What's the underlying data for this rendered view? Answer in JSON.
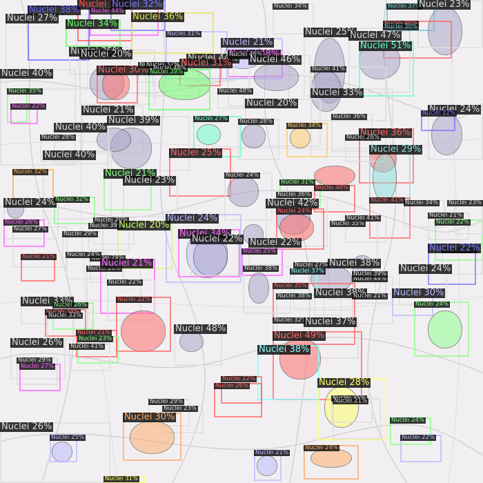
{
  "image": {
    "kind": "instance segmentation output over a microscopy photo",
    "class_name": "Nuclei"
  },
  "detections": [
    {
      "score": "Nuclei 38%",
      "color": "#6666ff",
      "size": "big"
    },
    {
      "score": "Nuclei 27%",
      "color": "#e0e0e0",
      "size": "big"
    },
    {
      "score": "Nuclei 25%",
      "color": "#ff4d4d",
      "size": "big"
    },
    {
      "score": "Nuclei 32%",
      "color": "#7777ff",
      "size": "big"
    },
    {
      "score": "Nuclei 37%",
      "color": "#66cccc",
      "size": "small"
    },
    {
      "score": "Nuclei 34%",
      "color": "#dddddd",
      "size": "small"
    },
    {
      "score": "Nuclei 23%",
      "color": "#dddddd",
      "size": "big"
    },
    {
      "score": "Nuclei 36%",
      "color": "#e6e64c",
      "size": "big"
    },
    {
      "score": "Nuclei 34%",
      "color": "#66ff66",
      "size": "big"
    },
    {
      "score": "Nuclei 44%",
      "color": "#ff66ff",
      "size": "small"
    },
    {
      "score": "Nuclei 40%",
      "color": "#ff6666",
      "size": "small"
    },
    {
      "score": "Nuclei 30%",
      "color": "#5fd6d6",
      "size": "small"
    },
    {
      "score": "Nuclei 31%",
      "color": "#bbbbff",
      "size": "small"
    },
    {
      "score": "Nuclei 21%",
      "color": "#bbbbff",
      "size": "big"
    },
    {
      "score": "Nuclei 25%",
      "color": "#dddddd",
      "size": "big"
    },
    {
      "score": "Nuclei 47%",
      "color": "#dddddd",
      "size": "big"
    },
    {
      "score": "Nuclei 51%",
      "color": "#66ffcc",
      "size": "big"
    },
    {
      "score": "Nuclei 35%",
      "color": "#dddddd",
      "size": "big"
    },
    {
      "score": "Nuclei 20%",
      "color": "#dddddd",
      "size": "big"
    },
    {
      "score": "Nuclei 44%",
      "color": "#dddddd",
      "size": "big"
    },
    {
      "score": "Nuclei 48%",
      "color": "#ff66ff",
      "size": "big"
    },
    {
      "score": "Nuclei 46%",
      "color": "#dddddd",
      "size": "small"
    },
    {
      "score": "Nuclei 46%",
      "color": "#dddddd",
      "size": "big"
    },
    {
      "score": "Nuclei 30%",
      "color": "#ff6666",
      "size": "big"
    },
    {
      "score": "Nuclei 31%",
      "color": "#ff6666",
      "size": "big"
    },
    {
      "score": "Nuclei 35%",
      "color": "#dddddd",
      "size": "small"
    },
    {
      "score": "Nuclei 37%",
      "color": "#dddddd",
      "size": "small"
    },
    {
      "score": "Nuclei 48%",
      "color": "#dddddd",
      "size": "small"
    },
    {
      "score": "Nuclei 40%",
      "color": "#dddddd",
      "size": "big"
    },
    {
      "score": "Nuclei 35%",
      "color": "#88ff88",
      "size": "small"
    },
    {
      "score": "Nuclei 22%",
      "color": "#ff66ff",
      "size": "small"
    },
    {
      "score": "Nuclei 39%",
      "color": "#66ff66",
      "size": "small"
    },
    {
      "score": "Nuclei 41%",
      "color": "#dddddd",
      "size": "small"
    },
    {
      "score": "Nuclei 33%",
      "color": "#dddddd",
      "size": "big"
    },
    {
      "score": "Nuclei 48%",
      "color": "#dddddd",
      "size": "small"
    },
    {
      "score": "Nuclei 20%",
      "color": "#dddddd",
      "size": "big"
    },
    {
      "score": "Nuclei 24%",
      "color": "#dddddd",
      "size": "big"
    },
    {
      "score": "Nuclei 22%",
      "color": "#7777ff",
      "size": "small"
    },
    {
      "score": "Nuclei 21%",
      "color": "#dddddd",
      "size": "big"
    },
    {
      "score": "Nuclei 39%",
      "color": "#dddddd",
      "size": "big"
    },
    {
      "score": "Nuclei 27%",
      "color": "#66ffcc",
      "size": "small"
    },
    {
      "score": "Nuclei 28%",
      "color": "#dddddd",
      "size": "small"
    },
    {
      "score": "Nuclei 34%",
      "color": "#ffcc66",
      "size": "small"
    },
    {
      "score": "Nuclei 36%",
      "color": "#dddddd",
      "size": "small"
    },
    {
      "score": "Nuclei 36%",
      "color": "#ff6666",
      "size": "big"
    },
    {
      "score": "Nuclei 26%",
      "color": "#dddddd",
      "size": "small"
    },
    {
      "score": "Nuclei 29%",
      "color": "#88dddd",
      "size": "big"
    },
    {
      "score": "Nuclei 40%",
      "color": "#dddddd",
      "size": "big"
    },
    {
      "score": "Nuclei 28%",
      "color": "#dddddd",
      "size": "small"
    },
    {
      "score": "Nuclei 40%",
      "color": "#dddddd",
      "size": "big"
    },
    {
      "score": "Nuclei 25%",
      "color": "#ff6666",
      "size": "big"
    },
    {
      "score": "Nuclei 21%",
      "color": "#88ff88",
      "size": "big"
    },
    {
      "score": "Nuclei 23%",
      "color": "#dddddd",
      "size": "big"
    },
    {
      "score": "Nuclei 24%",
      "color": "#dddddd",
      "size": "small"
    },
    {
      "score": "Nuclei 31%",
      "color": "#88ff88",
      "size": "small"
    },
    {
      "score": "Nuclei 40%",
      "color": "#ff6666",
      "size": "small"
    },
    {
      "score": "Nuclei 32%",
      "color": "#ffaa44",
      "size": "small"
    },
    {
      "score": "Nuclei 36%",
      "color": "#dddddd",
      "size": "small"
    },
    {
      "score": "Nuclei 24%",
      "color": "#dddddd",
      "size": "big"
    },
    {
      "score": "Nuclei 42%",
      "color": "#dddddd",
      "size": "big"
    },
    {
      "score": "Nuclei 41%",
      "color": "#ff6666",
      "size": "small"
    },
    {
      "score": "Nuclei 32%",
      "color": "#88ff88",
      "size": "small"
    },
    {
      "score": "Nuclei 26%",
      "color": "#ff66ff",
      "size": "small"
    },
    {
      "score": "Nuclei 27%",
      "color": "#dddddd",
      "size": "small"
    },
    {
      "score": "Nuclei 20%",
      "color": "#dddddd",
      "size": "small"
    },
    {
      "score": "Nuclei 39%",
      "color": "#dddddd",
      "size": "small"
    },
    {
      "score": "Nuclei 20%",
      "color": "#ccff66",
      "size": "big"
    },
    {
      "score": "Nuclei 24%",
      "color": "#bbbbff",
      "size": "big"
    },
    {
      "score": "Nuclei 24%",
      "color": "#ff6666",
      "size": "small"
    },
    {
      "score": "Nuclei 34%",
      "color": "#ff66ff",
      "size": "big"
    },
    {
      "score": "Nuclei 22%",
      "color": "#dddddd",
      "size": "big"
    },
    {
      "score": "Nuclei 22%",
      "color": "#dddddd",
      "size": "big"
    },
    {
      "score": "Nuclei 25%",
      "color": "#ff66ff",
      "size": "small"
    },
    {
      "score": "Nuclei 35%",
      "color": "#dddddd",
      "size": "small"
    },
    {
      "score": "Nuclei 41%",
      "color": "#dddddd",
      "size": "small"
    },
    {
      "score": "Nuclei 34%",
      "color": "#dddddd",
      "size": "small"
    },
    {
      "score": "Nuclei 21%",
      "color": "#dddddd",
      "size": "small"
    },
    {
      "score": "Nuclei 22%",
      "color": "#88ff88",
      "size": "small"
    },
    {
      "score": "Nuclei 31%",
      "color": "#dddddd",
      "size": "small"
    },
    {
      "score": "Nuclei 23%",
      "color": "#dddddd",
      "size": "small"
    },
    {
      "score": "Nuclei 22%",
      "color": "#7777ff",
      "size": "big"
    },
    {
      "score": "Nuclei 24%",
      "color": "#dddddd",
      "size": "big"
    },
    {
      "score": "Nuclei 29%",
      "color": "#dddddd",
      "size": "small"
    },
    {
      "score": "Nuclei 24%",
      "color": "#dddddd",
      "size": "small"
    },
    {
      "score": "Nuclei 26%",
      "color": "#dddddd",
      "size": "small"
    },
    {
      "score": "Nuclei 24%",
      "color": "#dddddd",
      "size": "small"
    },
    {
      "score": "Nuclei 21%",
      "color": "#ff6666",
      "size": "small"
    },
    {
      "score": "Nuclei 21%",
      "color": "#ff66ff",
      "size": "big"
    },
    {
      "score": "Nuclei 22%",
      "color": "#dddddd",
      "size": "small"
    },
    {
      "score": "Nuclei 22%",
      "color": "#ff6666",
      "size": "small"
    },
    {
      "score": "Nuclei 48%",
      "color": "#dddddd",
      "size": "big"
    },
    {
      "score": "Nuclei 38%",
      "color": "#dddddd",
      "size": "big"
    },
    {
      "score": "Nuclei 44%",
      "color": "#dddddd",
      "size": "small"
    },
    {
      "score": "Nuclei 39%",
      "color": "#dddddd",
      "size": "small"
    },
    {
      "score": "Nuclei 27%",
      "color": "#dddddd",
      "size": "small"
    },
    {
      "score": "Nuclei 37%",
      "color": "#88ffff",
      "size": "small"
    },
    {
      "score": "Nuclei 35%",
      "color": "#ff6666",
      "size": "small"
    },
    {
      "score": "Nuclei 38%",
      "color": "#dddddd",
      "size": "big"
    },
    {
      "score": "Nuclei 21%",
      "color": "#dddddd",
      "size": "small"
    },
    {
      "score": "Nuclei 38%",
      "color": "#dddddd",
      "size": "small"
    },
    {
      "score": "Nuclei 30%",
      "color": "#bbbbff",
      "size": "big"
    },
    {
      "score": "Nuclei 24%",
      "color": "#88ff88",
      "size": "small"
    },
    {
      "score": "Nuclei 33%",
      "color": "#dddddd",
      "size": "big"
    },
    {
      "score": "Nuclei 26%",
      "color": "#88ff88",
      "size": "small"
    },
    {
      "score": "Nuclei 34%",
      "color": "#ff6666",
      "size": "small"
    },
    {
      "score": "Nuclei 33%",
      "color": "#dddddd",
      "size": "small"
    },
    {
      "score": "Nuclei 32%",
      "color": "#dddddd",
      "size": "small"
    },
    {
      "score": "Nuclei 37%",
      "color": "#dddddd",
      "size": "big"
    },
    {
      "score": "Nuclei 49%",
      "color": "#ff6666",
      "size": "big"
    },
    {
      "score": "Nuclei 38%",
      "color": "#88ffff",
      "size": "big"
    },
    {
      "score": "Nuclei 21%",
      "color": "#ff6666",
      "size": "small"
    },
    {
      "score": "Nuclei 23%",
      "color": "#88ff88",
      "size": "small"
    },
    {
      "score": "Nuclei 41%",
      "color": "#dddddd",
      "size": "small"
    },
    {
      "score": "Nuclei 26%",
      "color": "#dddddd",
      "size": "big"
    },
    {
      "score": "Nuclei 29%",
      "color": "#dddddd",
      "size": "small"
    },
    {
      "score": "Nuclei 27%",
      "color": "#ff66ff",
      "size": "small"
    },
    {
      "score": "Nuclei 38%",
      "color": "#dddddd",
      "size": "small"
    },
    {
      "score": "Nuclei 22%",
      "color": "#ff6666",
      "size": "small"
    },
    {
      "score": "Nuclei 26%",
      "color": "#ff6666",
      "size": "small"
    },
    {
      "score": "Nuclei 28%",
      "color": "#ffff66",
      "size": "big"
    },
    {
      "score": "Nuclei 25%",
      "color": "#dddddd",
      "size": "small"
    },
    {
      "score": "Nuclei 21%",
      "color": "#dddddd",
      "size": "small"
    },
    {
      "score": "Nuclei 29%",
      "color": "#dddddd",
      "size": "small"
    },
    {
      "score": "Nuclei 23%",
      "color": "#dddddd",
      "size": "small"
    },
    {
      "score": "Nuclei 24%",
      "color": "#88ff88",
      "size": "small"
    },
    {
      "score": "Nuclei 22%",
      "color": "#bbbbff",
      "size": "small"
    },
    {
      "score": "Nuclei 26%",
      "color": "#dddddd",
      "size": "big"
    },
    {
      "score": "Nuclei 25%",
      "color": "#bbbbff",
      "size": "small"
    },
    {
      "score": "Nuclei 30%",
      "color": "#ffaa66",
      "size": "big"
    },
    {
      "score": "Nuclei 31%",
      "color": "#ffff66",
      "size": "small"
    },
    {
      "score": "Nuclei 21%",
      "color": "#bbbbff",
      "size": "small"
    },
    {
      "score": "Nuclei 24%",
      "color": "#ffaa66",
      "size": "small"
    }
  ]
}
